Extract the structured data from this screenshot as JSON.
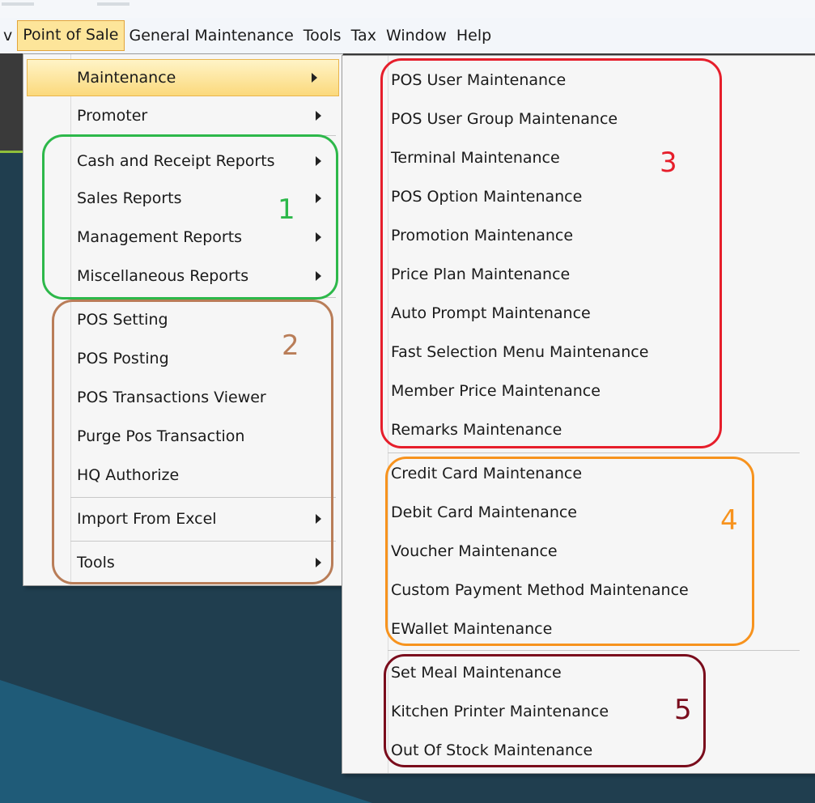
{
  "colors": {
    "menubar_bg": "#f3f6fa",
    "menu_bg": "#f6f6f6",
    "highlight_bg": "#fbd97c",
    "highlight_border": "#e9b54c",
    "app_bg": "#203e4f",
    "accent_line": "#8fbf3a",
    "annotation_1": "#2db84a",
    "annotation_2": "#b97d58",
    "annotation_3": "#e61e2b",
    "annotation_4": "#f7931e",
    "annotation_5": "#7a0c1c"
  },
  "menubar": {
    "items": [
      {
        "label": "v"
      },
      {
        "label": "Point of Sale"
      },
      {
        "label": "General Maintenance"
      },
      {
        "label": "Tools"
      },
      {
        "label": "Tax"
      },
      {
        "label": "Window"
      },
      {
        "label": "Help"
      }
    ]
  },
  "pos_menu": {
    "items": [
      {
        "label": "Maintenance",
        "submenu_icon": "arrow-right"
      },
      {
        "label": "Promoter",
        "submenu_icon": "arrow-right"
      },
      {
        "label": "Cash and Receipt Reports",
        "submenu_icon": "arrow-right"
      },
      {
        "label": "Sales Reports",
        "submenu_icon": "arrow-right"
      },
      {
        "label": "Management Reports",
        "submenu_icon": "arrow-right"
      },
      {
        "label": "Miscellaneous Reports",
        "submenu_icon": "arrow-right"
      },
      {
        "label": "POS Setting"
      },
      {
        "label": "POS Posting"
      },
      {
        "label": "POS Transactions Viewer"
      },
      {
        "label": "Purge Pos Transaction"
      },
      {
        "label": "HQ Authorize"
      },
      {
        "label": "Import From Excel",
        "submenu_icon": "arrow-right"
      },
      {
        "label": "Tools",
        "submenu_icon": "arrow-right"
      }
    ]
  },
  "maintenance_submenu": {
    "items": [
      {
        "label": "POS User Maintenance"
      },
      {
        "label": "POS User Group Maintenance"
      },
      {
        "label": "Terminal Maintenance"
      },
      {
        "label": "POS Option Maintenance"
      },
      {
        "label": "Promotion Maintenance"
      },
      {
        "label": "Price Plan Maintenance"
      },
      {
        "label": "Auto Prompt Maintenance"
      },
      {
        "label": "Fast Selection Menu Maintenance"
      },
      {
        "label": "Member Price Maintenance"
      },
      {
        "label": "Remarks Maintenance"
      },
      {
        "label": "Credit Card Maintenance"
      },
      {
        "label": "Debit Card Maintenance"
      },
      {
        "label": "Voucher Maintenance"
      },
      {
        "label": "Custom Payment Method Maintenance"
      },
      {
        "label": "EWallet Maintenance"
      },
      {
        "label": "Set Meal Maintenance"
      },
      {
        "label": "Kitchen Printer Maintenance"
      },
      {
        "label": "Out Of Stock Maintenance"
      }
    ]
  },
  "annotations": [
    {
      "label": "1"
    },
    {
      "label": "2"
    },
    {
      "label": "3"
    },
    {
      "label": "4"
    },
    {
      "label": "5"
    }
  ]
}
